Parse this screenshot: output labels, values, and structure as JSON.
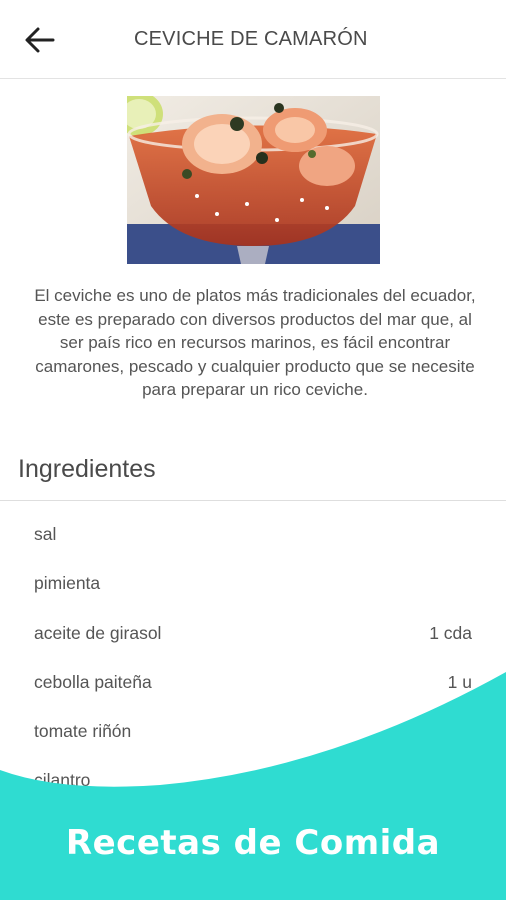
{
  "header": {
    "title": "CEVICHE DE CAMARÓN",
    "back_icon": "arrow-left-icon"
  },
  "recipe": {
    "image_alt": "ceviche de camarón",
    "description": "El ceviche es uno de platos más tradicionales del ecuador, este es preparado con diversos productos del mar que, al ser país rico en recursos marinos, es fácil encontrar camarones, pescado y cualquier producto que se necesite para preparar un rico ceviche."
  },
  "ingredients": {
    "title": "Ingredientes",
    "items": [
      {
        "name": "sal",
        "qty": ""
      },
      {
        "name": "pimienta",
        "qty": ""
      },
      {
        "name": "aceite de girasol",
        "qty": "1 cda"
      },
      {
        "name": "cebolla paiteña",
        "qty": "1 u"
      },
      {
        "name": "tomate riñón",
        "qty": ""
      },
      {
        "name": "cilantro",
        "qty": ""
      }
    ]
  },
  "banner": {
    "text": "Recetas de Comida",
    "color": "#2fdcd1"
  }
}
